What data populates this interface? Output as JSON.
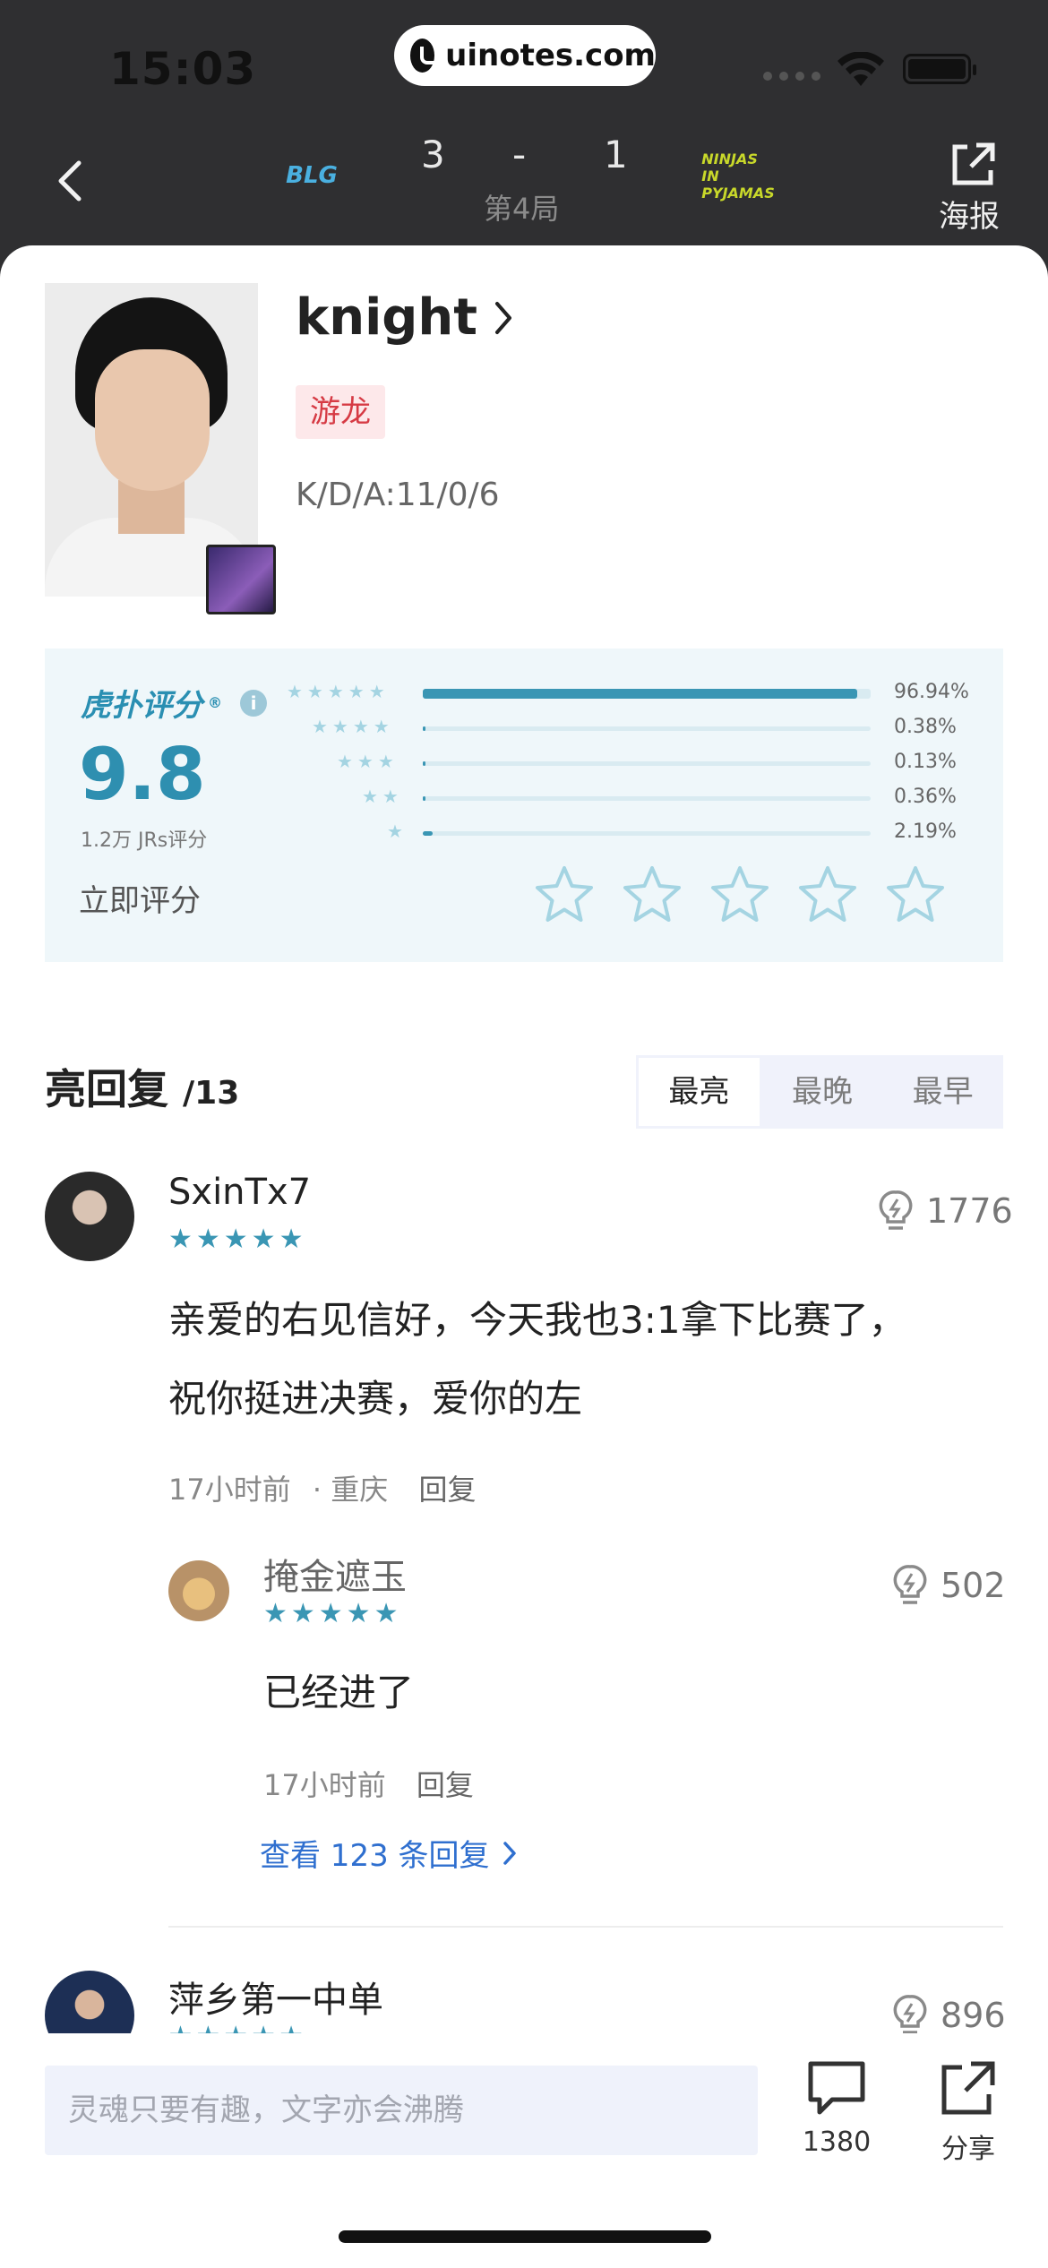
{
  "status_bar": {
    "time": "15:03",
    "url": "uinotes.com"
  },
  "match": {
    "team_left_logo": "BLG",
    "team_right_logo": "NINJAS IN PYJAMAS",
    "score_left": "3",
    "score_sep": "-",
    "score_right": "1",
    "game_label": "第4局",
    "poster_label": "海报"
  },
  "player": {
    "name": "knight",
    "role_tag": "游龙",
    "kda": "K/D/A:11/0/6"
  },
  "rating": {
    "brand": "虎扑评分",
    "brand_mark": "®",
    "score": "9.8",
    "count_label": "1.2万 JRs评分",
    "rate_now_label": "立即评分",
    "distribution": [
      {
        "stars": 5,
        "pct_label": "96.94%",
        "pct": 96.94
      },
      {
        "stars": 4,
        "pct_label": "0.38%",
        "pct": 0.38
      },
      {
        "stars": 3,
        "pct_label": "0.13%",
        "pct": 0.13
      },
      {
        "stars": 2,
        "pct_label": "0.36%",
        "pct": 0.36
      },
      {
        "stars": 1,
        "pct_label": "2.19%",
        "pct": 2.19
      }
    ],
    "user_rating": 0
  },
  "replies": {
    "title": "亮回复",
    "count": "/13",
    "sort_tabs": [
      "最亮",
      "最晚",
      "最早"
    ],
    "active_tab": 0
  },
  "comments": [
    {
      "user": "SxinTx7",
      "stars": 5,
      "likes": "1776",
      "text_line1": "亲爱的右见信好，今天我也3:1拿下比赛了，",
      "text_line2": "祝你挺进决赛，爱你的左",
      "time": "17小时前",
      "location": "· 重庆",
      "reply_label": "回复"
    },
    {
      "user": "掩金遮玉",
      "stars": 5,
      "likes": "502",
      "text": "已经进了",
      "time": "17小时前",
      "reply_label": "回复"
    },
    {
      "user": "萍乡第一中单",
      "stars": 5,
      "likes": "896"
    }
  ],
  "more_replies_label": "查看 123 条回复",
  "bottom_bar": {
    "input_placeholder": "灵魂只要有趣，文字亦会沸腾",
    "comment_count": "1380",
    "share_label": "分享"
  },
  "colors": {
    "accent": "#3a96b4",
    "link": "#2f6fcf",
    "tag_red": "#d63a44",
    "header_bg": "#2f2f31"
  },
  "icons": [
    "back-chevron-icon",
    "share-out-icon",
    "info-icon",
    "lightbulb-icon",
    "comment-bubble-icon",
    "star-icon"
  ]
}
